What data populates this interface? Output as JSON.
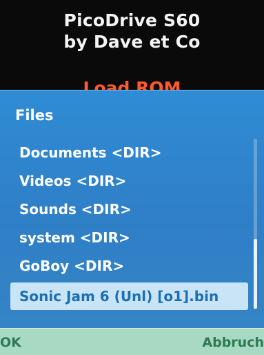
{
  "app": {
    "title_line1": "PicoDrive S60",
    "title_line2": "by Dave et Co",
    "menu_item": "Load ROM"
  },
  "dialog": {
    "title": "Files",
    "items": [
      {
        "label": "Documents <DIR>"
      },
      {
        "label": "Videos <DIR>"
      },
      {
        "label": "Sounds <DIR>"
      },
      {
        "label": "system <DIR>"
      },
      {
        "label": "GoBoy <DIR>"
      },
      {
        "label": "Sonic Jam 6 (Unl) [o1].bin"
      }
    ],
    "selected_index": 5
  },
  "softkeys": {
    "left": "OK",
    "right": "Abbruch"
  },
  "colors": {
    "dialog_bg": "#2f8cd4",
    "selection_bg": "#c9e4f7",
    "softkey_bg": "#a8d9c2",
    "accent": "#ff5a2a"
  }
}
